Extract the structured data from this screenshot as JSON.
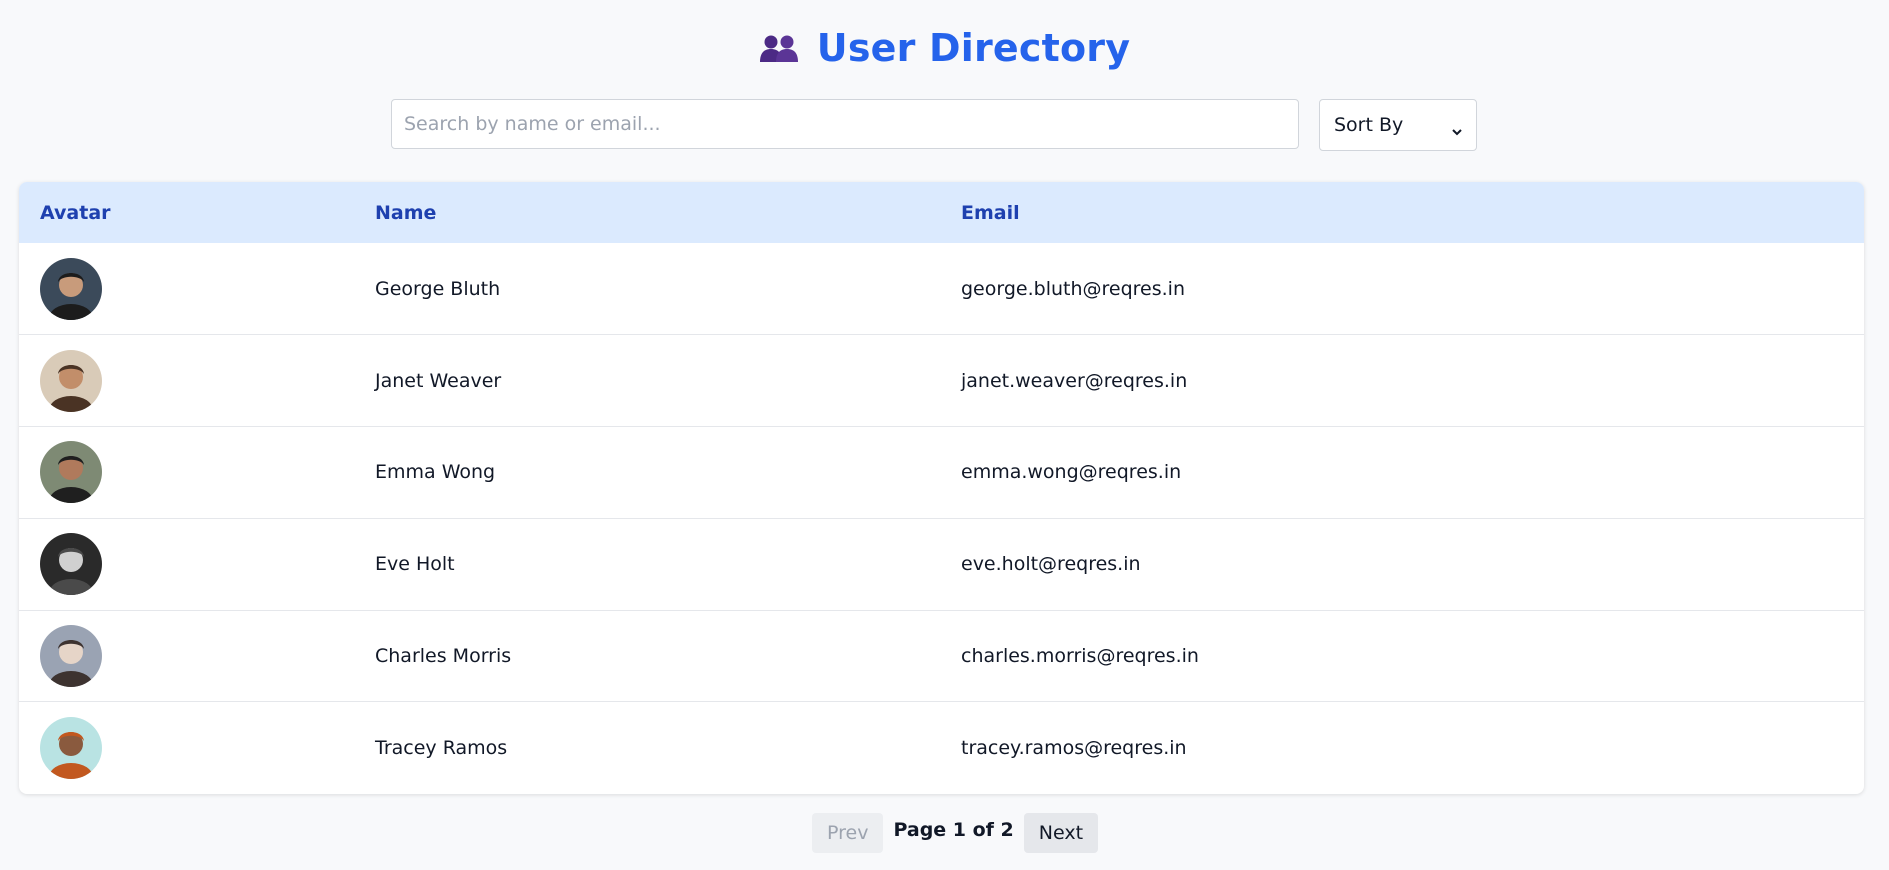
{
  "header": {
    "title": "User Directory",
    "icon": "users-icon"
  },
  "controls": {
    "search_placeholder": "Search by name or email...",
    "search_value": "",
    "sort_label": "Sort By"
  },
  "table": {
    "columns": [
      "Avatar",
      "Name",
      "Email"
    ],
    "rows": [
      {
        "name": "George Bluth",
        "email": "george.bluth@reqres.in",
        "avatar_colors": [
          "#3b4a5a",
          "#c89b7b",
          "#1c1c1c"
        ]
      },
      {
        "name": "Janet Weaver",
        "email": "janet.weaver@reqres.in",
        "avatar_colors": [
          "#d9cbb8",
          "#c28e6a",
          "#4a3324"
        ]
      },
      {
        "name": "Emma Wong",
        "email": "emma.wong@reqres.in",
        "avatar_colors": [
          "#7e8a74",
          "#b07a5c",
          "#1f1f1f"
        ]
      },
      {
        "name": "Eve Holt",
        "email": "eve.holt@reqres.in",
        "avatar_colors": [
          "#2a2a2a",
          "#d0d0d0",
          "#4a4a4a"
        ]
      },
      {
        "name": "Charles Morris",
        "email": "charles.morris@reqres.in",
        "avatar_colors": [
          "#9aa3b3",
          "#e6d5c8",
          "#3d3330"
        ]
      },
      {
        "name": "Tracey Ramos",
        "email": "tracey.ramos@reqres.in",
        "avatar_colors": [
          "#b9e3e3",
          "#8a5a3e",
          "#c2581f"
        ]
      }
    ]
  },
  "pagination": {
    "prev_label": "Prev",
    "page_info": "Page 1 of 2",
    "next_label": "Next"
  },
  "colors": {
    "accent": "#2563eb",
    "header_bg": "#dbeafe",
    "header_text": "#1e40af"
  }
}
